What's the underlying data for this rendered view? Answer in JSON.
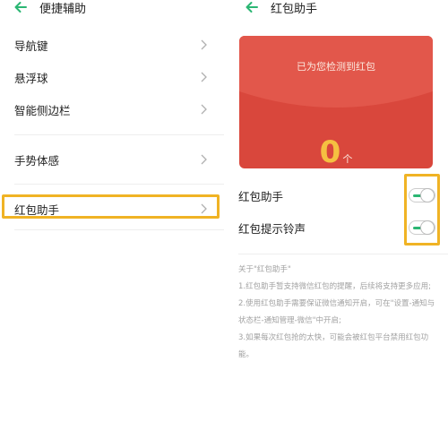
{
  "left": {
    "title": "便捷辅助",
    "items": [
      {
        "label": "导航键"
      },
      {
        "label": "悬浮球"
      },
      {
        "label": "智能侧边栏"
      },
      {
        "label": "手势体感"
      },
      {
        "label": "红包助手"
      }
    ]
  },
  "right": {
    "title": "红包助手",
    "card": {
      "caption": "已为您检测到红包",
      "count": "0",
      "unit": "个"
    },
    "toggles": [
      {
        "label": "红包助手",
        "on": true
      },
      {
        "label": "红包提示铃声",
        "on": true
      }
    ],
    "notes": [
      "关于\"红包助手\"",
      "1.红包助手暂支持微信红包的提醒，后续将支持更多应用;",
      "2.使用红包助手需要保证微信通知开启，可在\"设置-通知与",
      "状态栏-通知管理-微信\"中开启;",
      "3.如果每次红包抢的太快，可能会被红包平台禁用红包功",
      "能。"
    ]
  },
  "colors": {
    "accent": "#2bb673",
    "highlight": "#f0b324",
    "red_card": "#d9473c",
    "count_gold": "#f5c041"
  }
}
